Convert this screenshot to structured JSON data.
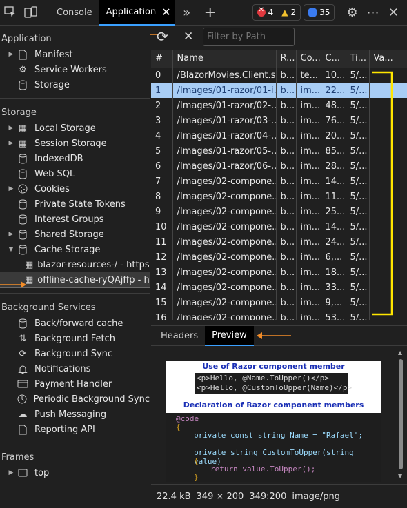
{
  "topbar": {
    "tabs": [
      {
        "label": "Console"
      },
      {
        "label": "Application"
      }
    ],
    "errors": "4",
    "warnings": "2",
    "messages": "35"
  },
  "sidebar": {
    "application": {
      "title": "Application",
      "items": [
        "Manifest",
        "Service Workers",
        "Storage"
      ]
    },
    "storage": {
      "title": "Storage",
      "items": [
        "Local Storage",
        "Session Storage",
        "IndexedDB",
        "Web SQL",
        "Cookies",
        "Private State Tokens",
        "Interest Groups",
        "Shared Storage",
        "Cache Storage"
      ],
      "cache_children": [
        "blazor-resources-/ - https:/",
        "offline-cache-ryQAjffp - ht"
      ]
    },
    "background": {
      "title": "Background Services",
      "items": [
        "Back/forward cache",
        "Background Fetch",
        "Background Sync",
        "Notifications",
        "Payment Handler",
        "Periodic Background Sync",
        "Push Messaging",
        "Reporting API"
      ]
    },
    "frames": {
      "title": "Frames",
      "items": [
        "top"
      ]
    }
  },
  "toolbar": {
    "filter_placeholder": "Filter by Path"
  },
  "table": {
    "columns": [
      "#",
      "Name",
      "R...",
      "Co...",
      "C...",
      "Ti...",
      "Va..."
    ],
    "rows": [
      [
        "0",
        "/BlazorMovies.Client.s...",
        "b...",
        "te...",
        "10...",
        "5/..."
      ],
      [
        "1",
        "/Images/01-razor/01-i...",
        "b...",
        "im...",
        "22...",
        "5/..."
      ],
      [
        "2",
        "/Images/01-razor/02-...",
        "b...",
        "im...",
        "48...",
        "5/..."
      ],
      [
        "3",
        "/Images/01-razor/03-...",
        "b...",
        "im...",
        "76...",
        "5/..."
      ],
      [
        "4",
        "/Images/01-razor/04-...",
        "b...",
        "im...",
        "20...",
        "5/..."
      ],
      [
        "5",
        "/Images/01-razor/05-...",
        "b...",
        "im...",
        "85...",
        "5/..."
      ],
      [
        "6",
        "/Images/01-razor/06-...",
        "b...",
        "im...",
        "28...",
        "5/..."
      ],
      [
        "7",
        "/Images/02-compone...",
        "b...",
        "im...",
        "14...",
        "5/..."
      ],
      [
        "8",
        "/Images/02-compone...",
        "b...",
        "im...",
        "11...",
        "5/..."
      ],
      [
        "9",
        "/Images/02-compone...",
        "b...",
        "im...",
        "25...",
        "5/..."
      ],
      [
        "10",
        "/Images/02-compone...",
        "b...",
        "im...",
        "14...",
        "5/..."
      ],
      [
        "11",
        "/Images/02-compone...",
        "b...",
        "im...",
        "24...",
        "5/..."
      ],
      [
        "12",
        "/Images/02-compone...",
        "b...",
        "im...",
        "6,...",
        "5/..."
      ],
      [
        "13",
        "/Images/02-compone...",
        "b...",
        "im...",
        "18...",
        "5/..."
      ],
      [
        "14",
        "/Images/02-compone...",
        "b...",
        "im...",
        "33...",
        "5/..."
      ],
      [
        "15",
        "/Images/02-compone...",
        "b...",
        "im...",
        "9,...",
        "5/..."
      ],
      [
        "16",
        "/Images/02-compone...",
        "b...",
        "im...",
        "53...",
        "5/..."
      ]
    ]
  },
  "subtabs": {
    "headers": "Headers",
    "preview": "Preview"
  },
  "preview": {
    "heading1": "Use of Razor component member",
    "code1": "<p>Hello, @Name.ToUpper()</p>",
    "code2": "<p>Hello, @CustomToUpper(Name)</p>",
    "heading2": "Declaration of Razor component members",
    "code_lines": [
      "@code",
      "{",
      "private const string Name = \"Rafael\";",
      "private string CustomToUpper(string value)",
      "{",
      "return value.ToUpper();",
      "}"
    ]
  },
  "status": {
    "size": "22.4 kB",
    "dims": "349 × 200",
    "ratio": "349:200",
    "mime": "image/png"
  },
  "colors": {
    "accent": "#3aa0ff",
    "annotation_orange": "#f28c28",
    "annotation_yellow": "#ffe600",
    "selected_row": "#a8cdf5"
  }
}
